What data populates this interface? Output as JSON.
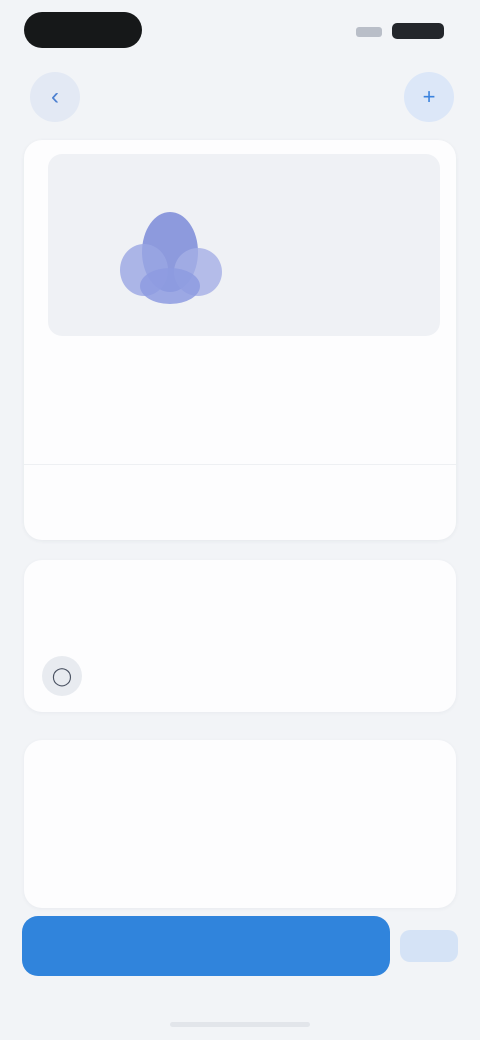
{
  "status_bar": {
    "time_pill_color": "#161819",
    "signal_icon": "cellular-signal-icon",
    "battery_icon": "battery-icon"
  },
  "nav": {
    "back_icon": "chevron-left-icon",
    "back_glyph": "‹",
    "title": "",
    "action_icon": "plus-icon",
    "action_glyph": "+"
  },
  "hero": {
    "illustration_icon": "blue-flower-illustration",
    "heading": "",
    "subheading": "",
    "value": ""
  },
  "details": [
    {
      "label": "",
      "value": ""
    },
    {
      "label": "",
      "value": ""
    }
  ],
  "card_link": "",
  "selection": {
    "title": "",
    "description": "",
    "option_icon": "circle-option-icon",
    "option_glyph": "◯",
    "option_label": ""
  },
  "about": {
    "title": "",
    "text": ""
  },
  "primary_button": "",
  "secondary_action": "",
  "colors": {
    "background": "#f2f4f7",
    "accent": "#3084dc",
    "illustration": "#8896dc"
  }
}
